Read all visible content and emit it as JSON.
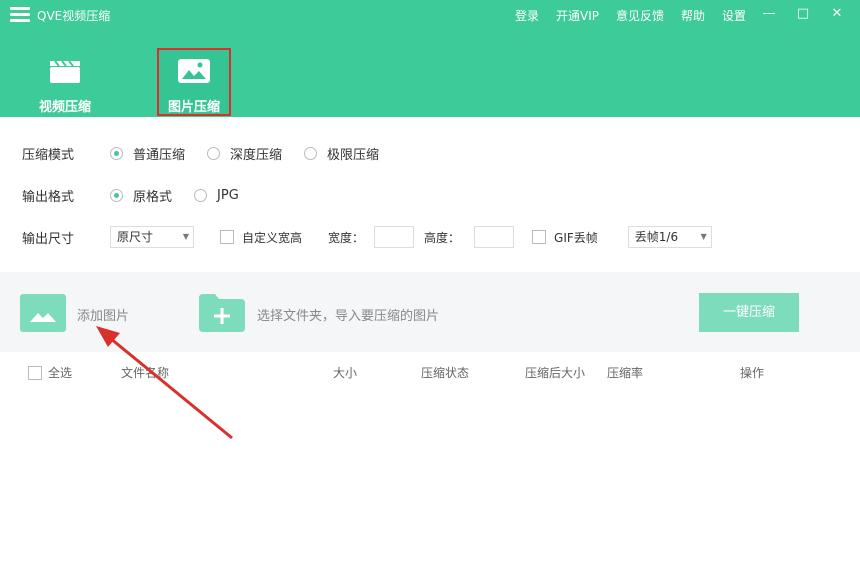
{
  "window": {
    "title": "QVE视频压缩",
    "nav": [
      "登录",
      "开通VIP",
      "意见反馈",
      "帮助",
      "设置"
    ],
    "minimize": "—",
    "restore": "□",
    "close": "✕"
  },
  "tabs": {
    "video": "视频压缩",
    "image": "图片压缩"
  },
  "settings": {
    "mode_label": "压缩模式",
    "mode_options": [
      "普通压缩",
      "深度压缩",
      "极限压缩"
    ],
    "mode_selected": "普通压缩",
    "format_label": "输出格式",
    "format_options": [
      "原格式",
      "JPG"
    ],
    "format_selected": "原格式",
    "size_label": "输出尺寸",
    "size_value": "原尺寸",
    "custom_size": "自定义宽高",
    "width_label": "宽度：",
    "height_label": "高度：",
    "gif_label": "GIF丢帧",
    "gif_value": "丢帧1/6"
  },
  "toolbar": {
    "add_image": "添加图片",
    "folder_hint": "选择文件夹，导入要压缩的图片",
    "compress_all": "一键压缩"
  },
  "table": {
    "select_all": "全选",
    "columns": [
      "文件名称",
      "大小",
      "压缩状态",
      "压缩后大小",
      "压缩率",
      "操作"
    ]
  },
  "colors": {
    "accent": "#3ccb99",
    "accent_light": "#7ddcbb",
    "highlight": "#d9302c"
  }
}
